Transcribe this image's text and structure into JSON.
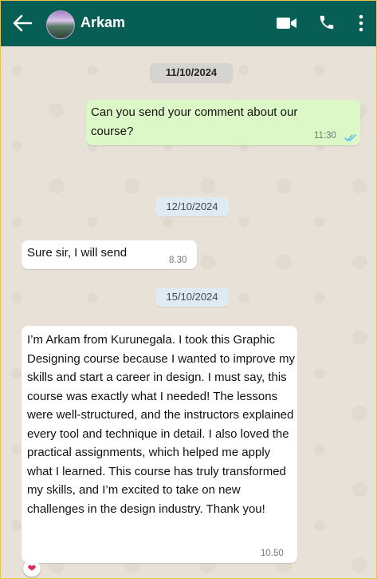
{
  "header": {
    "contact_name": "Arkam",
    "icons": [
      "back-arrow-icon",
      "video-call-icon",
      "phone-icon",
      "more-options-icon"
    ],
    "background_color": "#075e54"
  },
  "chat": {
    "messages": [
      {
        "type": "date",
        "text": "11/10/2024"
      },
      {
        "type": "outgoing",
        "text": "Can you send your comment about our course?",
        "time": "11:30",
        "status": "read"
      },
      {
        "type": "date",
        "text": "12/10/2024"
      },
      {
        "type": "incoming",
        "text": "Sure sir, I will send",
        "time": "8.30"
      },
      {
        "type": "date",
        "text": "15/10/2024"
      },
      {
        "type": "incoming",
        "text": "I’m Arkam from Kurunegala. I took this Graphic Designing course because I wanted to improve my skills and start a career in design. I must say, this course was exactly what I needed! The lessons were well-structured, and the instructors explained every tool and technique in detail. I also loved the practical assignments, which helped me apply what I learned. This course has truly transformed my skills, and I’m excited to take on new challenges in the design industry. Thank you!",
        "time": "10.50",
        "reaction": "❤"
      }
    ]
  },
  "colors": {
    "outgoing_bubble": "#dcf8c6",
    "incoming_bubble": "#ffffff",
    "chat_background": "#e7e1d8",
    "read_ticks": "#4fb6ec"
  }
}
